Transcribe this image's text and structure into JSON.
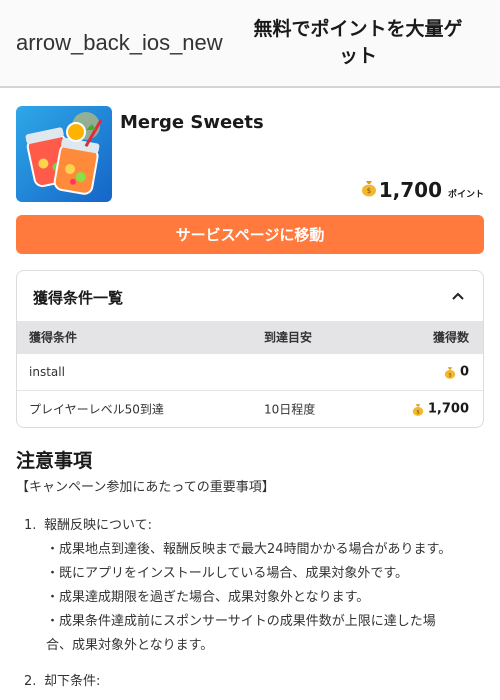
{
  "header": {
    "back_icon_text": "arrow_back_ios_new",
    "title": "無料でポイントを大量ゲット"
  },
  "app": {
    "name": "Merge Sweets",
    "reward_amount": "1,700",
    "reward_unit": "ポイント",
    "icon": "juice-jars-icon"
  },
  "cta_label": "サービスページに移動",
  "conditions": {
    "title": "獲得条件一覧",
    "toggle_icon": "chevron-up-icon",
    "headers": [
      "獲得条件",
      "到達目安",
      "獲得数"
    ],
    "rows": [
      {
        "condition": "install",
        "estimate": "",
        "points": "0"
      },
      {
        "condition": "プレイヤーレベル50到達",
        "estimate": "10日程度",
        "points": "1,700"
      }
    ]
  },
  "notes": {
    "title": "注意事項",
    "subtitle": "【キャンペーン参加にあたっての重要事項】",
    "items": [
      {
        "num": "1.",
        "label": "報酬反映について:",
        "bullets": [
          "・成果地点到達後、報酬反映まで最大24時間かかる場合があります。",
          "・既にアプリをインストールしている場合、成果対象外です。",
          "・成果達成期限を過ぎた場合、成果対象外となります。",
          "・成果条件達成前にスポンサーサイトの成果件数が上限に達した場",
          "合、成果対象外となります。"
        ]
      },
      {
        "num": "2.",
        "label": "却下条件:",
        "bullets": []
      }
    ]
  },
  "colors": {
    "cta": "#ff7a3c",
    "table_header_bg": "#e4e4e6"
  }
}
